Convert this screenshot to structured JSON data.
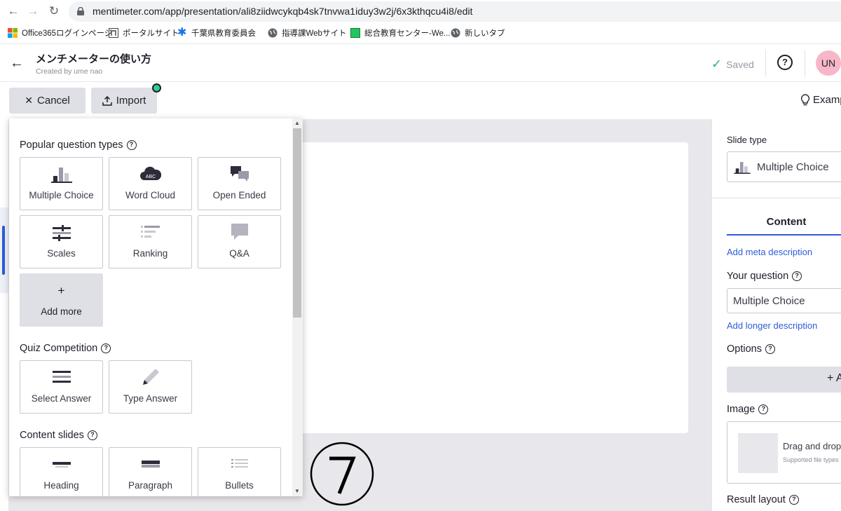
{
  "browser": {
    "url": "mentimeter.com/app/presentation/ali8ziidwcykqb4sk7tnvwa1iduy3w2j/6x3kthqcu4i8/edit",
    "bookmarks": [
      {
        "label": "Office365ログインページ",
        "icon": "microsoft-icon"
      },
      {
        "label": "ポータルサイト",
        "icon": "portal-icon"
      },
      {
        "label": "千葉県教育委員会",
        "icon": "star-asterisk-icon"
      },
      {
        "label": "指導課Webサイト",
        "icon": "globe-icon"
      },
      {
        "label": "総合教育センター-We...",
        "icon": "site-icon"
      },
      {
        "label": "新しいタブ",
        "icon": "globe-icon"
      }
    ]
  },
  "header": {
    "title": "メンチメーターの使い方",
    "subtitle": "Created by ume nao",
    "saved_label": "Saved",
    "help_label": "?",
    "avatar_initials": "UN"
  },
  "toolbar": {
    "cancel_label": "Cancel",
    "import_label": "Import",
    "examples_label": "Examp"
  },
  "popup": {
    "popular_title": "Popular question types",
    "popular_types": [
      {
        "label": "Multiple Choice",
        "icon": "bar-chart-icon"
      },
      {
        "label": "Word Cloud",
        "icon": "word-cloud-icon"
      },
      {
        "label": "Open Ended",
        "icon": "speech-bubbles-icon"
      },
      {
        "label": "Scales",
        "icon": "scales-icon"
      },
      {
        "label": "Ranking",
        "icon": "ranking-icon"
      },
      {
        "label": "Q&A",
        "icon": "qa-bubble-icon"
      }
    ],
    "add_more_symbol": "+",
    "add_more_label": "Add more",
    "quiz_title": "Quiz Competition",
    "quiz_types": [
      {
        "label": "Select Answer",
        "icon": "select-lines-icon"
      },
      {
        "label": "Type Answer",
        "icon": "pencil-icon"
      }
    ],
    "content_title": "Content slides",
    "content_types": [
      {
        "label": "Heading",
        "icon": "heading-icon"
      },
      {
        "label": "Paragraph",
        "icon": "paragraph-icon"
      },
      {
        "label": "Bullets",
        "icon": "bullets-icon"
      }
    ]
  },
  "right_panel": {
    "slide_type_label": "Slide type",
    "slide_type_value": "Multiple Choice",
    "content_tab": "Content",
    "add_meta_link": "Add meta description",
    "your_question_label": "Your question",
    "question_value": "Multiple Choice",
    "add_longer_link": "Add longer description",
    "options_label": "Options",
    "add_option_label": "+ A",
    "image_label": "Image",
    "drag_drop_text": "Drag and drop",
    "supported_text": "Supported file types",
    "result_layout_label": "Result layout"
  },
  "colors": {
    "accent_blue": "#2e5cd6",
    "saved_green": "#2fb37a",
    "avatar_pink": "#f7b7c8",
    "badge_green": "#2fd08e"
  }
}
